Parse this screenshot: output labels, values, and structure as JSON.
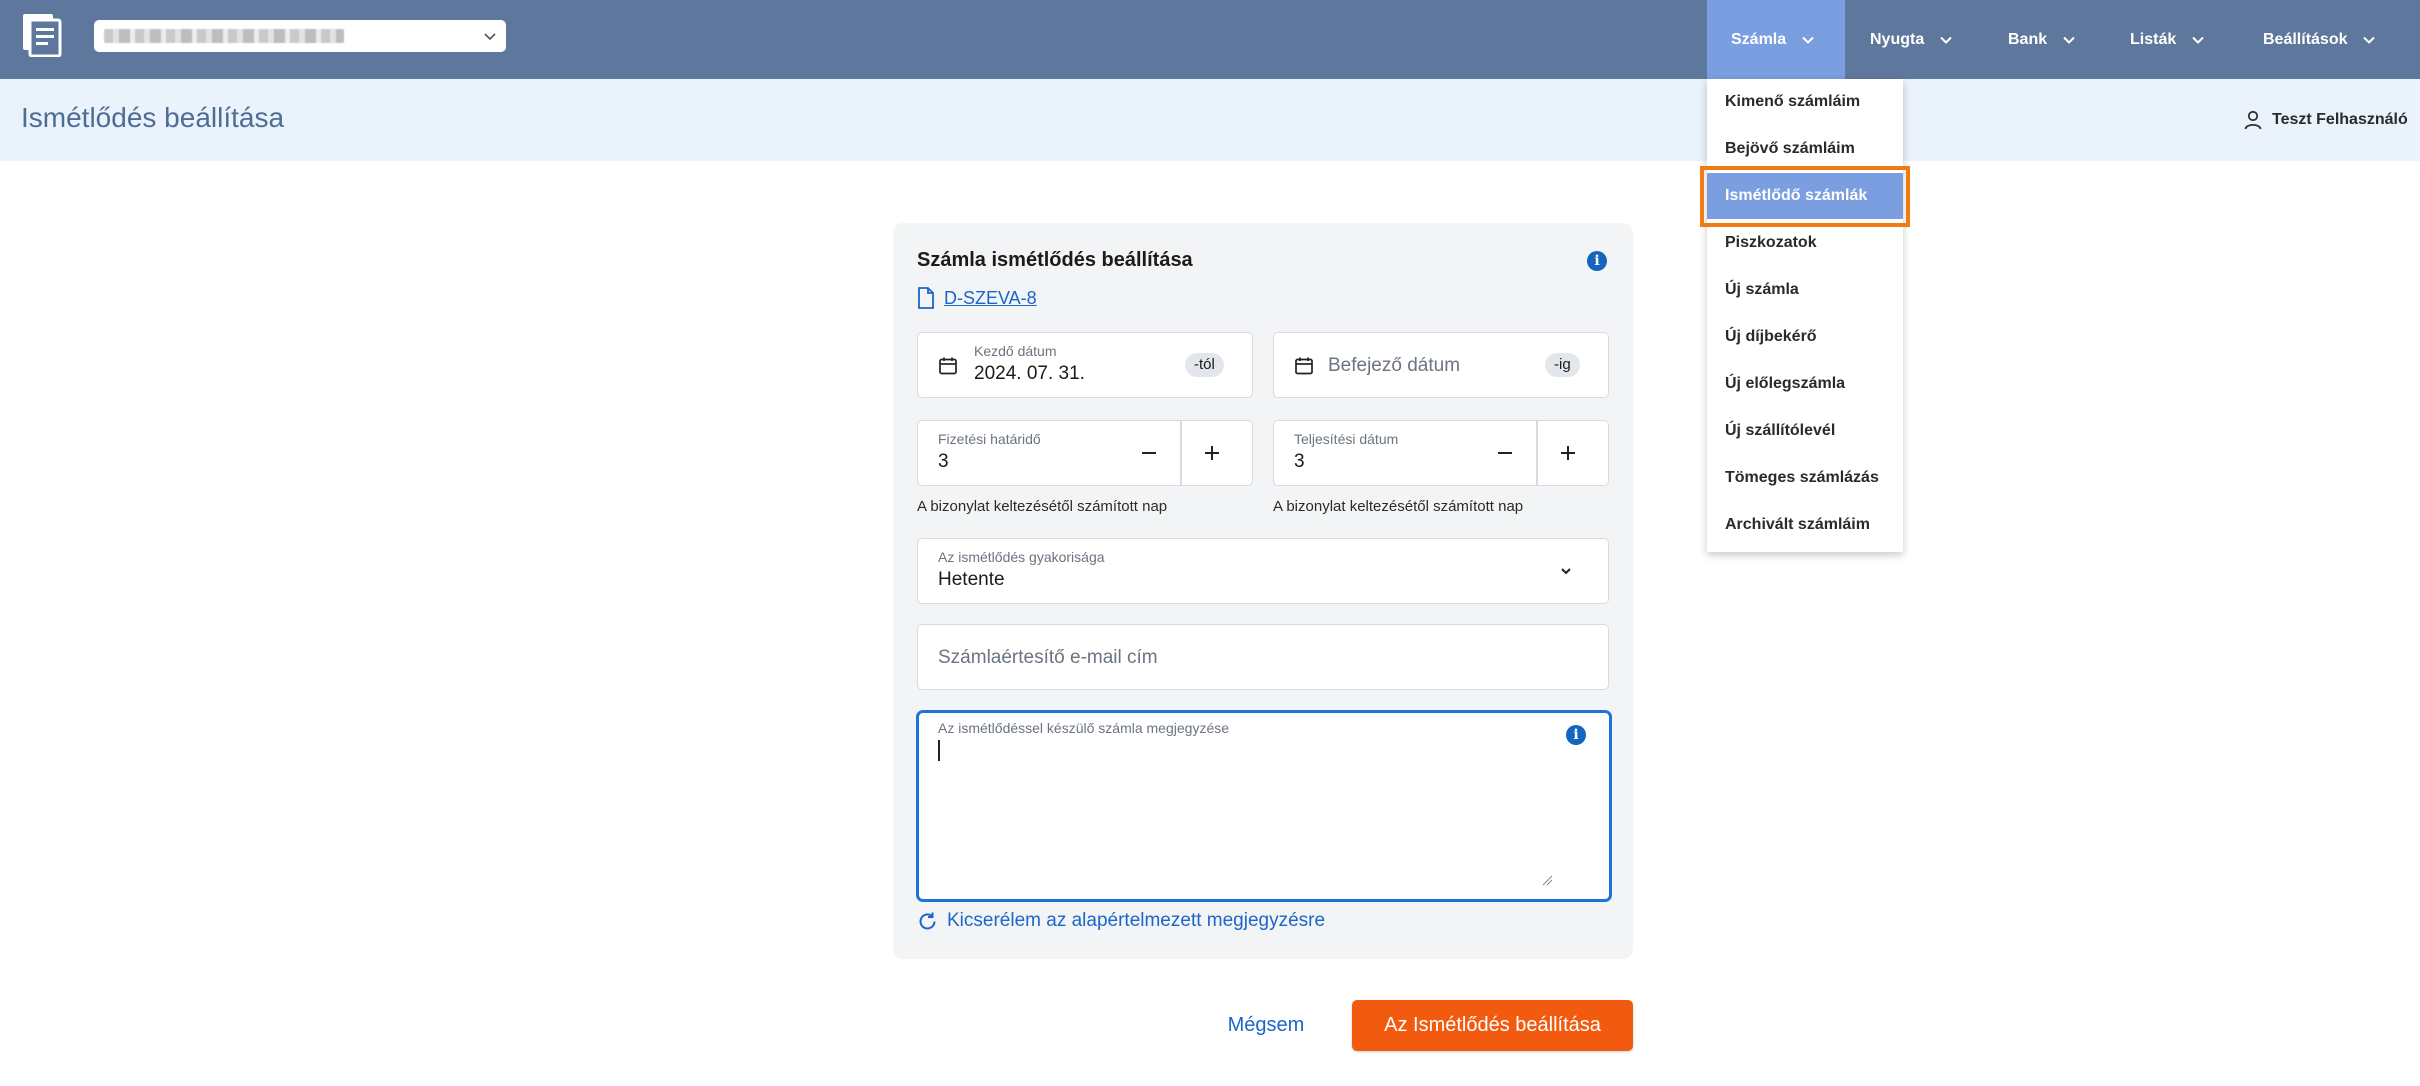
{
  "nav": {
    "items": [
      {
        "label": "Számla"
      },
      {
        "label": "Nyugta"
      },
      {
        "label": "Bank"
      },
      {
        "label": "Listák"
      },
      {
        "label": "Beállítások"
      }
    ],
    "active_index": 0
  },
  "page": {
    "title": "Ismétlődés beállítása",
    "user_name": "Teszt Felhasználó"
  },
  "menu": {
    "items": [
      {
        "label": "Kimenő számláim"
      },
      {
        "label": "Bejövő számláim"
      },
      {
        "label": "Ismétlődő számlák"
      },
      {
        "label": "Piszkozatok"
      },
      {
        "label": "Új számla"
      },
      {
        "label": "Új díjbekérő"
      },
      {
        "label": "Új előlegszámla"
      },
      {
        "label": "Új szállítólevél"
      },
      {
        "label": "Tömeges számlázás"
      },
      {
        "label": "Archivált számláim"
      }
    ],
    "selected_index": 2
  },
  "card": {
    "title": "Számla ismétlődés beállítása",
    "document_link": "D-SZEVA-8",
    "start_date": {
      "label": "Kezdő dátum",
      "value": "2024. 07. 31.",
      "suffix": "-tól"
    },
    "end_date": {
      "placeholder": "Befejező dátum",
      "suffix": "-ig"
    },
    "payment_deadline": {
      "label": "Fizetési határidő",
      "value": "3",
      "hint": "A bizonylat keltezésétől számított nap"
    },
    "fulfillment_date": {
      "label": "Teljesítési dátum",
      "value": "3",
      "hint": "A bizonylat keltezésétől számított nap"
    },
    "frequency": {
      "label": "Az ismétlődés gyakorisága",
      "value": "Hetente"
    },
    "email": {
      "placeholder": "Számlaértesítő e-mail cím"
    },
    "note": {
      "label": "Az ismétlődéssel készülő számla megjegyzése",
      "value": ""
    },
    "reset_link": "Kicserélem az alapértelmezett megjegyzésre"
  },
  "actions": {
    "cancel": "Mégsem",
    "submit": "Az Ismétlődés beállítása"
  },
  "colors": {
    "navbar": "#5e779c",
    "nav_active": "#7a9ee0",
    "header_band": "#eaf2fb",
    "primary_link": "#1b66c9",
    "submit": "#f25a0f",
    "highlight_outline": "#f07a13"
  }
}
